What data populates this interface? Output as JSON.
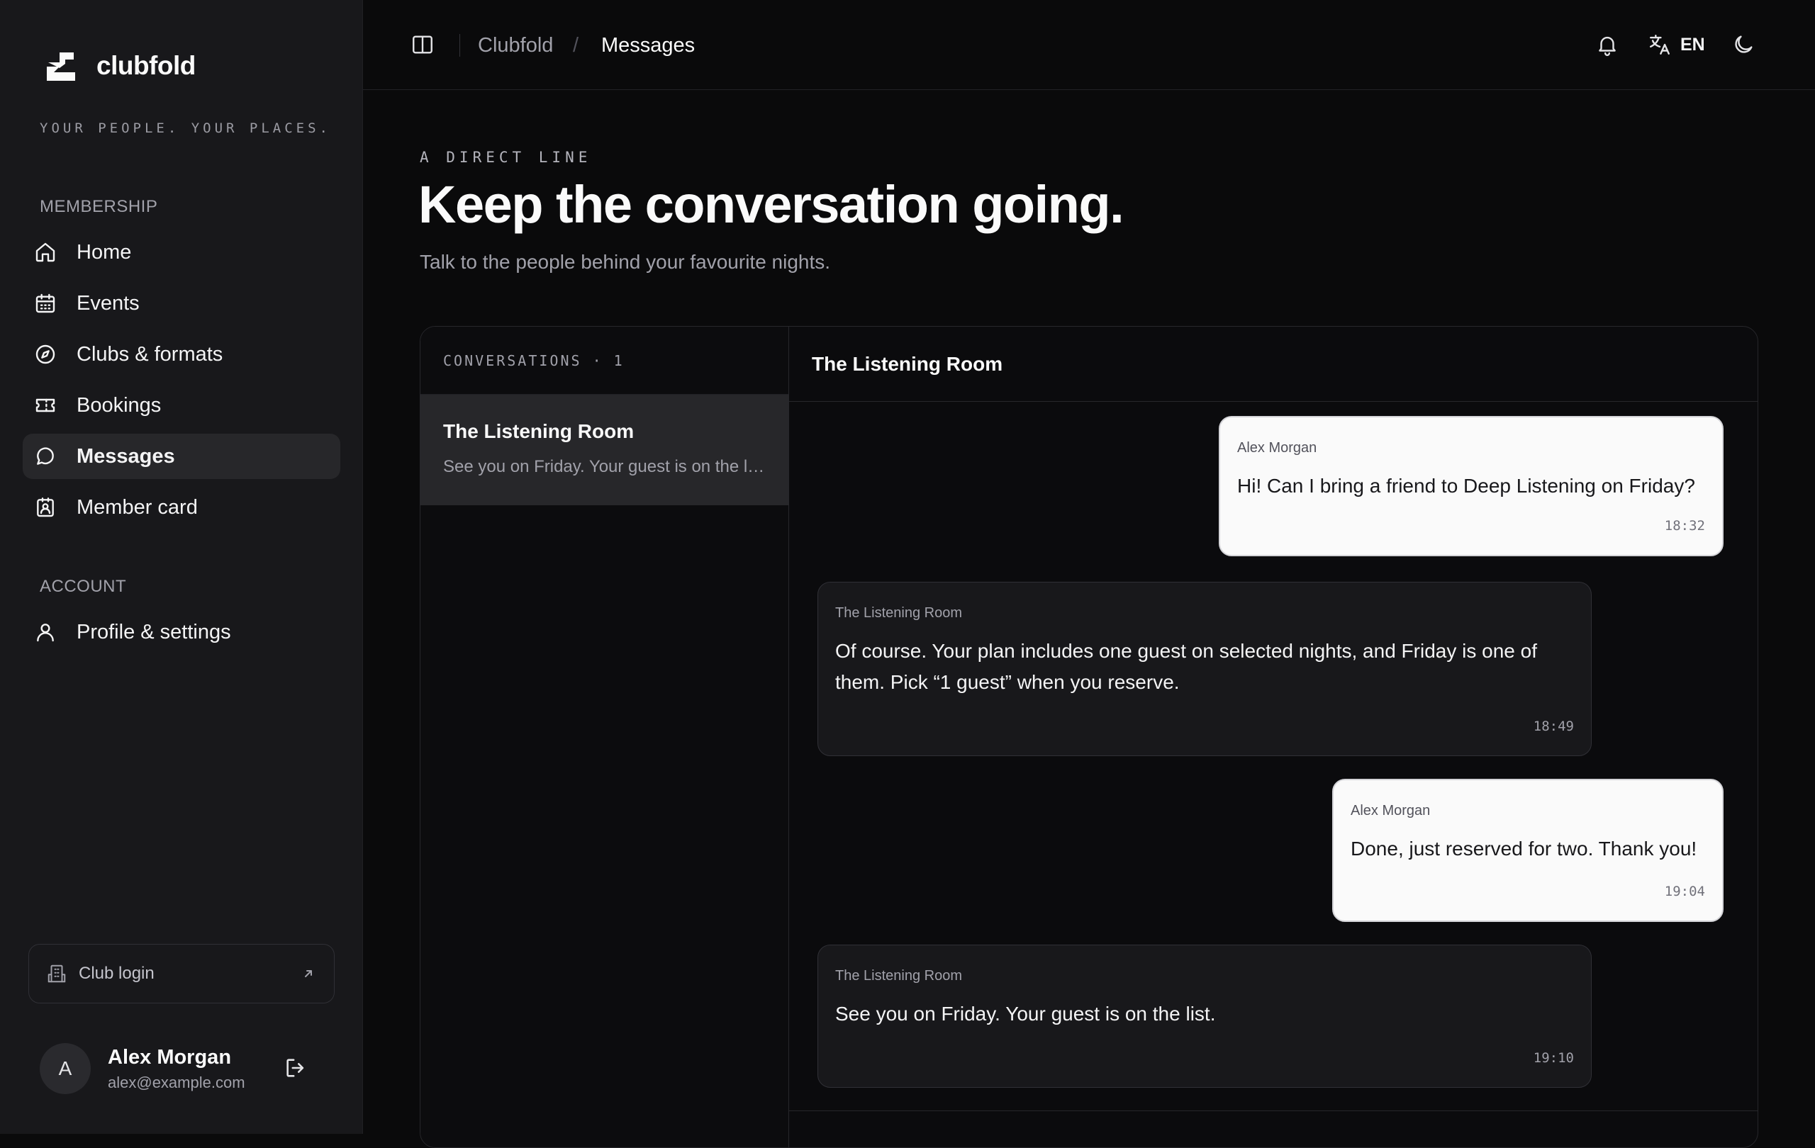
{
  "brand": {
    "name": "clubfold",
    "tagline": "YOUR PEOPLE. YOUR PLACES."
  },
  "sidebar": {
    "sections": [
      {
        "label": "MEMBERSHIP",
        "items": [
          {
            "label": "Home",
            "icon": "home-icon"
          },
          {
            "label": "Events",
            "icon": "calendar-icon"
          },
          {
            "label": "Clubs & formats",
            "icon": "compass-icon"
          },
          {
            "label": "Bookings",
            "icon": "ticket-icon"
          },
          {
            "label": "Messages",
            "icon": "message-icon",
            "active": true
          },
          {
            "label": "Member card",
            "icon": "id-card-icon"
          }
        ]
      },
      {
        "label": "ACCOUNT",
        "items": [
          {
            "label": "Profile & settings",
            "icon": "user-icon"
          }
        ]
      }
    ],
    "club_login": "Club login",
    "user": {
      "initial": "A",
      "name": "Alex Morgan",
      "email": "alex@example.com"
    }
  },
  "topbar": {
    "breadcrumb": {
      "root": "Clubfold",
      "separator": "/",
      "current": "Messages"
    },
    "language": "EN"
  },
  "hero": {
    "eyebrow": "A DIRECT LINE",
    "title": "Keep the conversation going.",
    "subtitle": "Talk to the people behind your favourite nights."
  },
  "conversations": {
    "header": "CONVERSATIONS · 1",
    "items": [
      {
        "title": "The Listening Room",
        "preview": "See you on Friday. Your guest is on the list."
      }
    ]
  },
  "thread": {
    "title": "The Listening Room",
    "messages": [
      {
        "sender": "Alex Morgan",
        "text": "Hi! Can I bring a friend to Deep Listening on Friday?",
        "time": "18:32",
        "mine": true
      },
      {
        "sender": "The Listening Room",
        "text": "Of course. Your plan includes one guest on selected nights, and Friday is one of them. Pick “1 guest” when you reserve.",
        "time": "18:49",
        "mine": false
      },
      {
        "sender": "Alex Morgan",
        "text": "Done, just reserved for two. Thank you!",
        "time": "19:04",
        "mine": true
      },
      {
        "sender": "The Listening Room",
        "text": "See you on Friday. Your guest is on the list.",
        "time": "19:10",
        "mine": false
      }
    ]
  },
  "colors": {
    "background": "#0a0a0b",
    "sidebar": "#18181b",
    "active_item": "#27272a",
    "own_bubble": "#fafafa",
    "other_bubble": "#18181b"
  }
}
